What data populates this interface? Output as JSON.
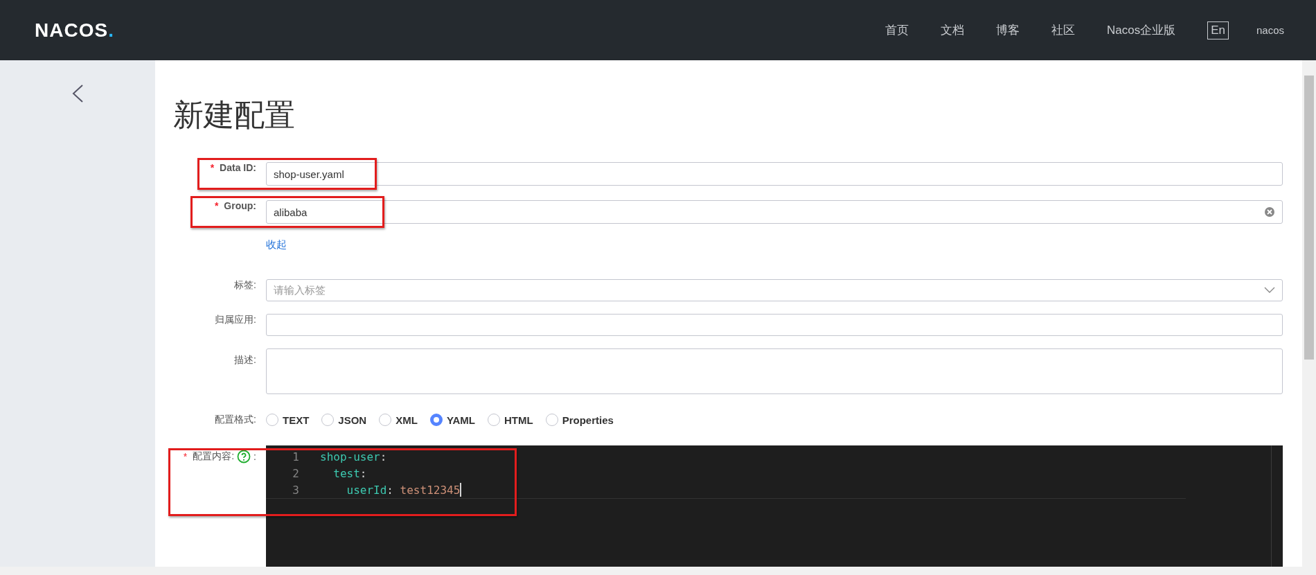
{
  "header": {
    "logo": "NACOS.",
    "nav": [
      "首页",
      "文档",
      "博客",
      "社区",
      "Nacos企业版"
    ],
    "language": "En",
    "user": "nacos"
  },
  "page": {
    "title": "新建配置"
  },
  "form": {
    "fields": [
      {
        "kind": "input",
        "label": "Data ID:",
        "required_mark": "*",
        "value": "shop-user.yaml",
        "highlighted": true,
        "clearable": false
      },
      {
        "kind": "input",
        "label": "Group:",
        "required_mark": "*",
        "value": "alibaba",
        "highlighted": true,
        "clearable": true
      }
    ],
    "collapse_link": "收起",
    "extra_fields": [
      {
        "kind": "select",
        "label": "标签:",
        "placeholder": "请输入标签"
      },
      {
        "kind": "input",
        "label": "归属应用:"
      },
      {
        "kind": "textarea",
        "label": "描述:"
      }
    ],
    "format": {
      "label": "配置格式:",
      "options": [
        {
          "label": "TEXT",
          "selected": false
        },
        {
          "label": "JSON",
          "selected": false
        },
        {
          "label": "XML",
          "selected": false
        },
        {
          "label": "YAML",
          "selected": true
        },
        {
          "label": "HTML",
          "selected": false
        },
        {
          "label": "Properties",
          "selected": false
        }
      ]
    },
    "content": {
      "label": "配置内容:",
      "suffix": ":",
      "required_mark": "*",
      "highlighted": true,
      "lines": [
        {
          "number": "1",
          "cursor": false,
          "tokens": [
            {
              "kind": "key",
              "text": "shop-user"
            },
            {
              "kind": "punct",
              "text": ":"
            }
          ]
        },
        {
          "number": "2",
          "cursor": false,
          "tokens": [
            {
              "kind": "key",
              "text": "  test"
            },
            {
              "kind": "punct",
              "text": ":"
            }
          ]
        },
        {
          "number": "3",
          "cursor": true,
          "tokens": [
            {
              "kind": "key",
              "text": "    userId"
            },
            {
              "kind": "punct",
              "text": ": "
            },
            {
              "kind": "string",
              "text": "test12345"
            }
          ]
        }
      ]
    }
  }
}
